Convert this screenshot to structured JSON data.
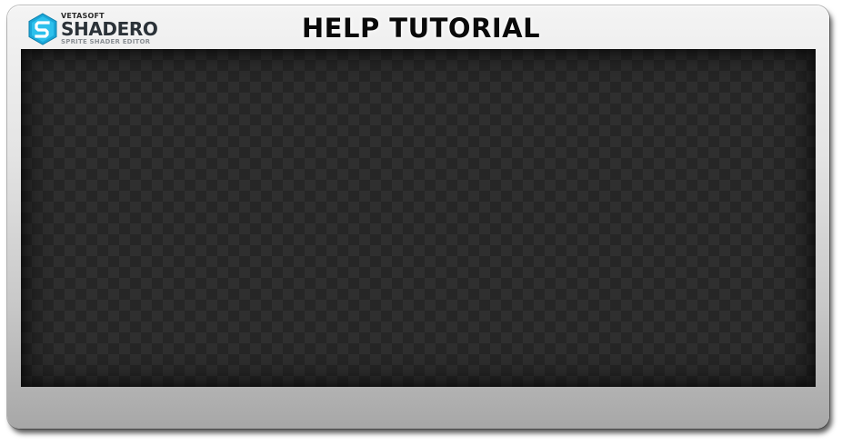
{
  "window": {
    "title": "HELP TUTORIAL"
  },
  "logo": {
    "vendor": "VETASOFT",
    "product": "SHADERO",
    "tagline": "SPRITE SHADER EDITOR",
    "icon": "shadero-logo-icon",
    "accent_color": "#1aa7d8"
  },
  "viewport": {
    "background": "checkerboard",
    "colors": [
      "#2f2f2f",
      "#262626"
    ]
  }
}
